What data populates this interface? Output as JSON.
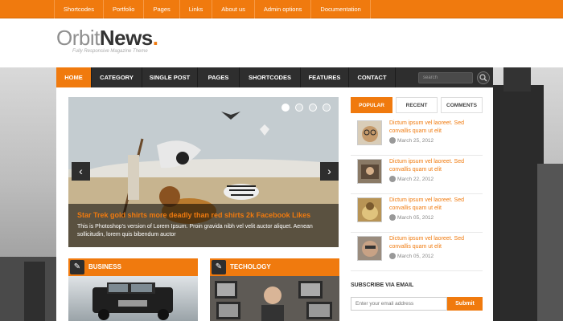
{
  "topbar": {
    "items": [
      "Shortcodes",
      "Portfolio",
      "Pages",
      "Links",
      "About us",
      "Admin options",
      "Documentation"
    ]
  },
  "header": {
    "logo_part1": "Orbit",
    "logo_part2": "News",
    "logo_dot": ".",
    "tagline": "Fully Responsive Magazine Theme"
  },
  "nav": {
    "items": [
      "HOME",
      "CATEGORY",
      "SINGLE POST",
      "PAGES",
      "SHORTCODES",
      "FEATURES",
      "CONTACT"
    ],
    "active": "HOME",
    "search_placeholder": "search",
    "search_icon": "search-icon"
  },
  "slider": {
    "title": "Star Trek gold shirts more deadly than red shirts 2k Facebook Likes",
    "text": "This is Photoshop's version of Lorem Ipsum. Proin gravida nibh vel velit auctor aliquet. Aenean sollicitudin, lorem quis bibendum auctor",
    "prev_icon": "chevron-left-icon",
    "next_icon": "chevron-right-icon",
    "slide_count": 4,
    "active_slide": 1
  },
  "sections": [
    {
      "title": "BUSINESS",
      "icon": "pencil-icon"
    },
    {
      "title": "TECHOLOGY",
      "icon": "pencil-icon"
    }
  ],
  "sidebar": {
    "tabs": [
      "POPULAR",
      "RECENT",
      "COMMENTS"
    ],
    "active_tab": "POPULAR",
    "posts": [
      {
        "title": "Dictum ipsum vel laoreet. Sed convallis quam ut elit",
        "date": "March 25, 2012"
      },
      {
        "title": "Dictum ipsum vel laoreet. Sed convallis quam ut elit",
        "date": "March 22, 2012"
      },
      {
        "title": "Dictum ipsum vel laoreet. Sed convallis quam ut elit",
        "date": "March 05, 2012"
      },
      {
        "title": "Dictum ipsum vel laoreet. Sed convallis quam ut elit",
        "date": "March 05, 2012"
      }
    ],
    "subscribe_heading": "SUBSCRIBE VIA EMAIL",
    "email_placeholder": "Enter your email address",
    "subscribe_button": "Submit"
  },
  "colors": {
    "accent": "#f07a0e",
    "nav_bg": "#2e2e2e",
    "link": "#f07a0e"
  }
}
